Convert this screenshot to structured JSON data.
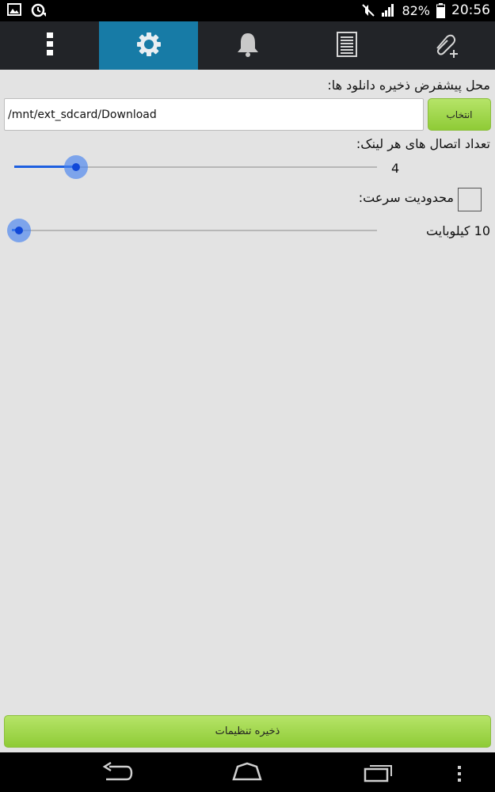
{
  "status_bar": {
    "battery": "82%",
    "time": "20:56",
    "icons": [
      "image-icon",
      "sync-icon",
      "mute-icon",
      "signal-icon",
      "battery-icon"
    ]
  },
  "toolbar": {
    "items": [
      {
        "name": "overflow-menu-icon"
      },
      {
        "name": "settings-icon",
        "active": true
      },
      {
        "name": "notifications-icon"
      },
      {
        "name": "list-icon"
      },
      {
        "name": "attach-add-icon"
      }
    ],
    "active_color": "#177ba6"
  },
  "settings": {
    "download_location_label": "محل پیشفرض ذخیره دانلود ها:",
    "download_path": "/mnt/ext_sdcard/Download",
    "choose_button": "انتخاب",
    "connections_label": "تعداد اتصال های هر لینک:",
    "connections_value": "4",
    "connections_fraction": 0.17,
    "speed_limit_label": "محدودیت سرعت:",
    "speed_limit_checked": false,
    "speed_value": "10 کیلوبایت",
    "speed_fraction": 0.02,
    "save_button": "ذخیره تنظیمات"
  },
  "colors": {
    "accent_green": "#9ad544",
    "slider_blue": "#1d5fe0",
    "background": "#e3e3e3"
  },
  "nav_bar": {
    "buttons": [
      "back-icon",
      "home-icon",
      "recents-icon",
      "menu-icon"
    ]
  }
}
